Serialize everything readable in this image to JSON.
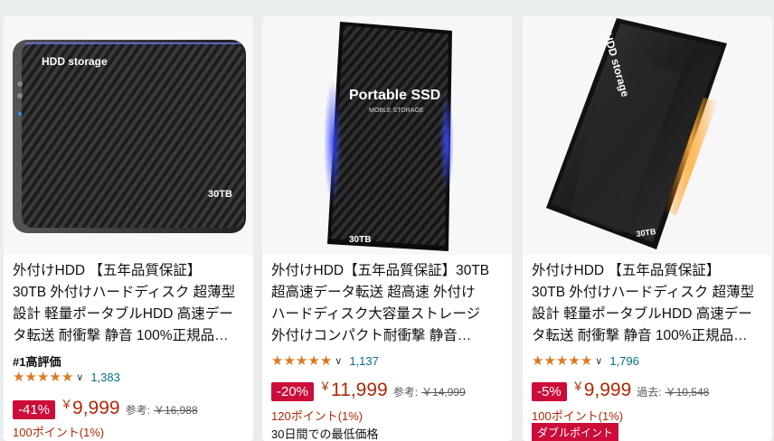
{
  "products": [
    {
      "image_text": {
        "brand": "HDD storage",
        "capacity": "30TB"
      },
      "title_lines": [
        "外付けHDD 【五年品質保証】",
        "30TB 外付けハードディスク 超薄型",
        "設計 軽量ポータブルHDD 高速デー",
        "タ転送 耐衝撃 静音 100%正規品…"
      ],
      "badge": "#1高評価",
      "rating_count": "1,383",
      "discount": "-41%",
      "currency": "￥",
      "price": "9,999",
      "ref_label": "参考:",
      "ref_price": "￥16,988",
      "points": "100ポイント(1%)"
    },
    {
      "image_text": {
        "brand": "Portable SSD",
        "sub": "MOBLE STORAGE",
        "capacity": "30TB"
      },
      "title_lines": [
        "外付けHDD【五年品質保証】30TB",
        "超高速データ転送 超高速 外付け",
        "ハードディスク大容量ストレージ",
        "外付けコンパクト耐衝撃 静音…"
      ],
      "rating_count": "1,137",
      "discount": "-20%",
      "currency": "￥",
      "price": "11,999",
      "ref_label": "参考:",
      "ref_price": "￥14,999",
      "points": "120ポイント(1%)",
      "extra": "30日間での最低価格"
    },
    {
      "image_text": {
        "brand": "HDD storage",
        "capacity": "30TB"
      },
      "title_lines": [
        "外付けHDD 【五年品質保証】",
        "30TB 外付けハードディスク 超薄型",
        "設計 軽量ポータブルHDD 高速デー",
        "タ転送 耐衝撃 静音 100%正規品…"
      ],
      "rating_count": "1,796",
      "discount": "-5%",
      "currency": "￥",
      "price": "9,999",
      "ref_label": "過去:",
      "ref_price": "￥10,548",
      "points": "100ポイント(1%)",
      "extra_badge": "ダブルポイント"
    }
  ],
  "colors": {
    "star": "#de7921",
    "price": "#b12704",
    "discount_bg": "#cc0c39",
    "link": "#007185"
  }
}
